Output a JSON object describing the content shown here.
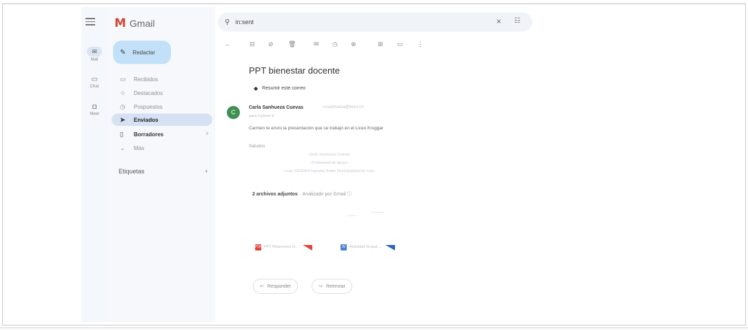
{
  "rail": {
    "items": [
      {
        "label": "Mail",
        "icon": "mail-icon",
        "glyph": "✉"
      },
      {
        "label": "Chat",
        "icon": "chat-icon",
        "glyph": "▭"
      },
      {
        "label": "Meet",
        "icon": "meet-icon",
        "glyph": "◘"
      }
    ]
  },
  "brand": {
    "name": "Gmail",
    "colors": {
      "red": "#d44638",
      "blue": "#4285f4"
    }
  },
  "compose": {
    "label": "Redactar"
  },
  "nav": {
    "items": [
      {
        "label": "Recibidos",
        "icon": "inbox-icon",
        "glyph": "▭"
      },
      {
        "label": "Destacados",
        "icon": "star-icon",
        "glyph": "☆"
      },
      {
        "label": "Pospuestos",
        "icon": "clock-icon",
        "glyph": "◷"
      },
      {
        "label": "Enviados",
        "icon": "send-icon",
        "glyph": "➤"
      },
      {
        "label": "Borradores",
        "icon": "draft-icon",
        "glyph": "▯",
        "count": "9"
      },
      {
        "label": "Más",
        "icon": "chevron-down-icon",
        "glyph": "⌄"
      }
    ],
    "labels_title": "Etiquetas",
    "labels_add": "+"
  },
  "search": {
    "value": "in:sent",
    "clear": "×",
    "options": "☷"
  },
  "toolbar": [
    "←",
    "⊟",
    "⊘",
    "🗑",
    "✉",
    "◷",
    "⊕",
    "⊞",
    "▭",
    "⋮"
  ],
  "message": {
    "subject": "PPT bienestar docente",
    "summarize": "Resumir este correo",
    "avatar_letter": "C",
    "sender_name": "Carla Sanhueza Cuevas",
    "sender_email": "<csanhueza@liceo.cl>",
    "to": "para Carmen ▾",
    "body": "Carmen te envío la presentación que se trabajó en el Liceo Kruggar",
    "greeting": "Saludos",
    "signature": [
      "Carla Sanhueza Cuevas",
      "Profesional de Apoyo",
      "Liceo SENDA Programa Rotter Municipalidad de Lonc"
    ],
    "attachments_count": "2 archivos adjuntos",
    "attachments_scan": "· Analizado por Gmail ⓘ",
    "attachments": [
      {
        "name": "PPT Relaciones In...",
        "type": "PDF",
        "color": "#e0463c"
      },
      {
        "name": "Actividad Grupal ...",
        "type": "W",
        "color": "#4a7fd6"
      }
    ],
    "reply": "Responder",
    "forward": "Reenviar"
  }
}
